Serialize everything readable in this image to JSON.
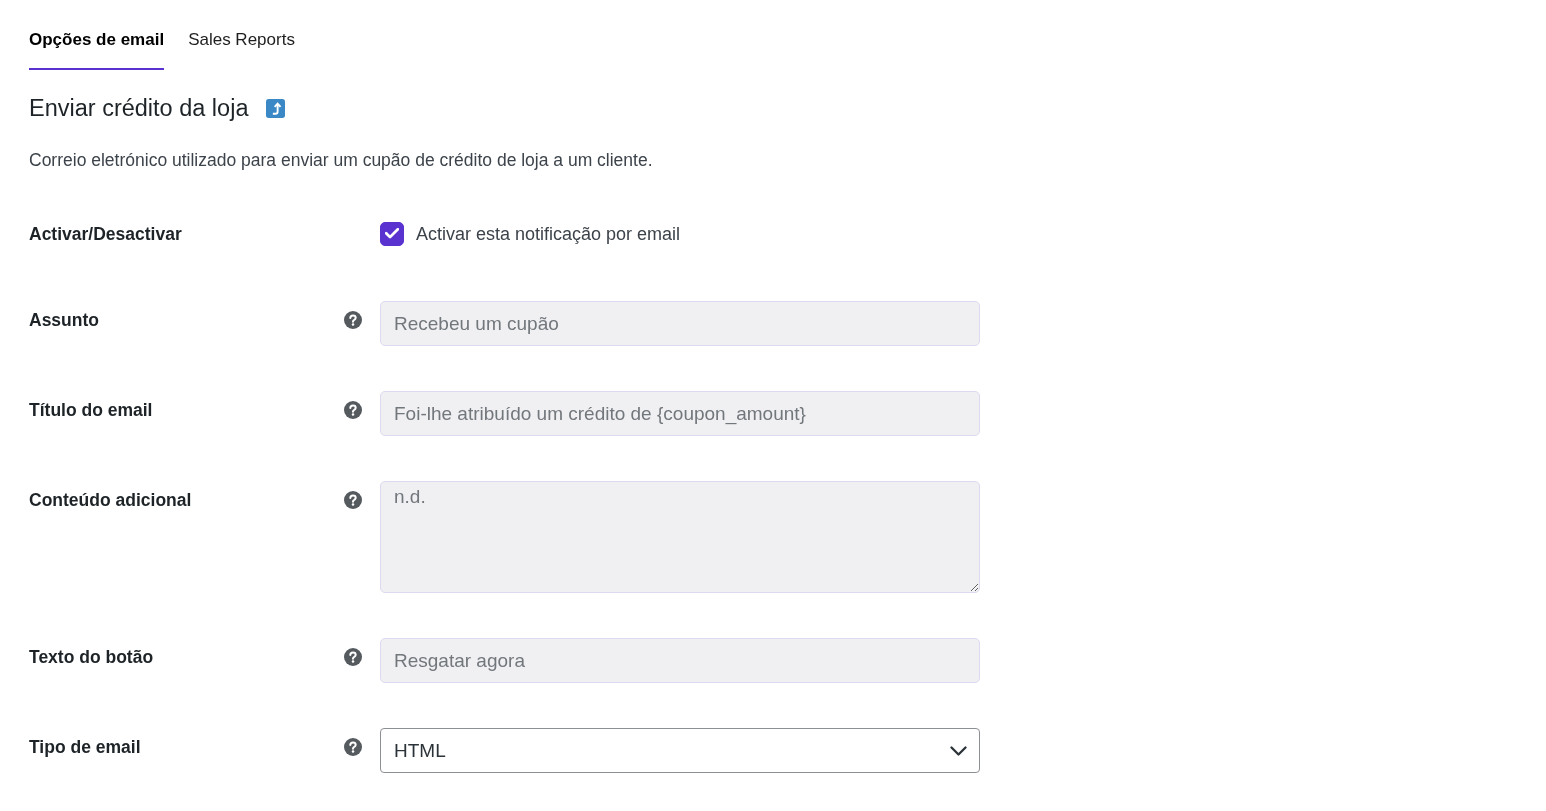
{
  "tabs": [
    {
      "label": "Opções de email",
      "selected": true
    },
    {
      "label": "Sales Reports",
      "selected": false
    }
  ],
  "heading": {
    "title": "Enviar crédito da loja"
  },
  "description": "Correio eletrónico utilizado para enviar um cupão de crédito de loja a um cliente.",
  "fields": [
    {
      "kind": "checkbox",
      "label": "Activar/Desactivar",
      "help": false,
      "checkbox_label": "Activar esta notificação por email",
      "checked": true
    },
    {
      "kind": "text",
      "label": "Assunto",
      "help": true,
      "placeholder": "Recebeu um cupão"
    },
    {
      "kind": "text",
      "label": "Título do email",
      "help": true,
      "placeholder": "Foi-lhe atribuído um crédito de {coupon_amount}"
    },
    {
      "kind": "textarea",
      "label": "Conteúdo adicional",
      "help": true,
      "placeholder": "n.d."
    },
    {
      "kind": "text",
      "label": "Texto do botão",
      "help": true,
      "placeholder": "Resgatar agora"
    },
    {
      "kind": "select",
      "label": "Tipo de email",
      "help": true,
      "value": "HTML"
    }
  ]
}
